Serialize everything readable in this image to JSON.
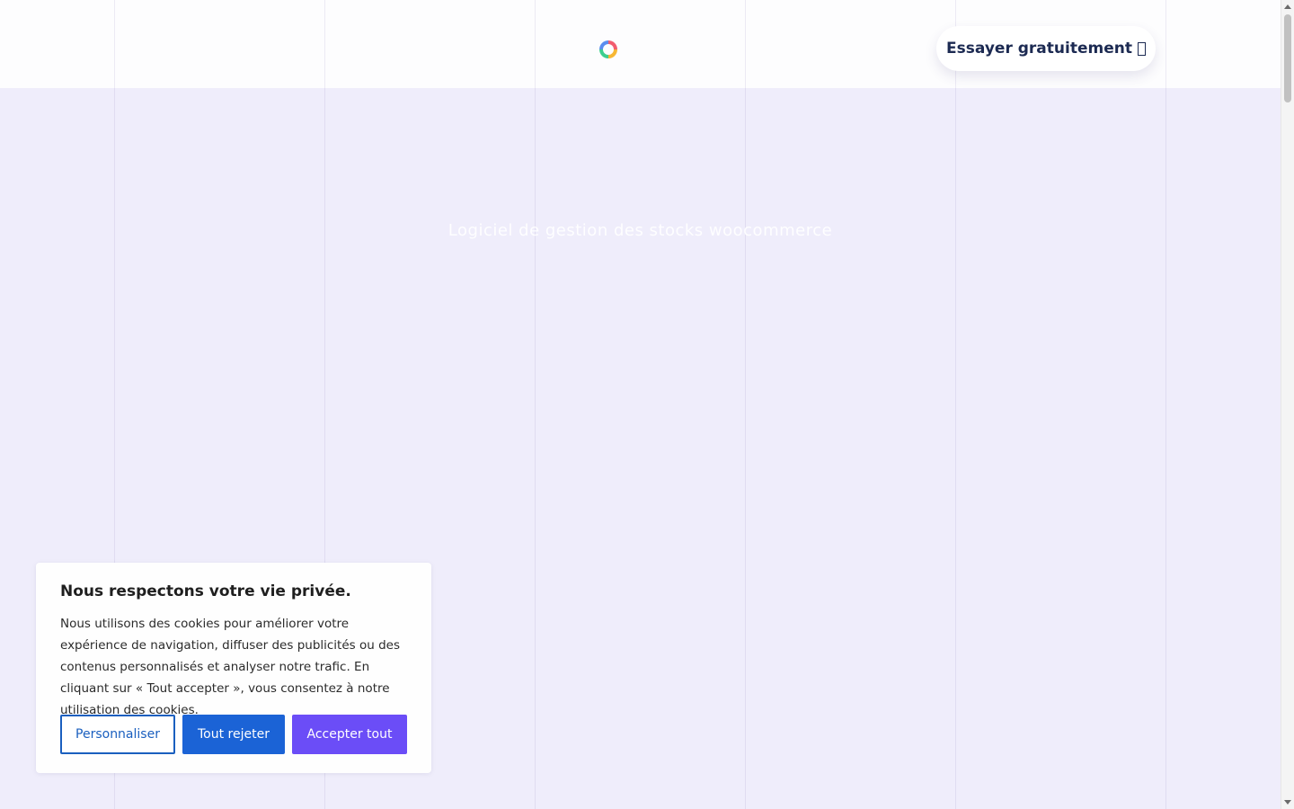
{
  "header": {
    "logo_icon": "ring-logo-icon",
    "cta_label": "Essayer gratuitement",
    "cta_icon": "missing-glyph-icon"
  },
  "hero": {
    "title": "Logiciel de gestion des stocks woocommerce"
  },
  "cookie_banner": {
    "title": "Nous respectons votre vie privée.",
    "body": "Nous utilisons des cookies pour améliorer votre expérience de navigation, diffuser des publicités ou des contenus personnalisés et analyser notre trafic. En cliquant sur « Tout accepter », vous consentez à notre utilisation des cookies.",
    "customize_label": "Personnaliser",
    "reject_label": "Tout rejeter",
    "accept_label": "Accepter tout"
  },
  "colors": {
    "page_bg": "#efedfb",
    "header_line": "#4a3fb0",
    "cta_text": "#1c2a52",
    "customize_border": "#1a5fbf",
    "reject_bg": "#1b63d6",
    "accept_bg": "#6b4df7"
  }
}
